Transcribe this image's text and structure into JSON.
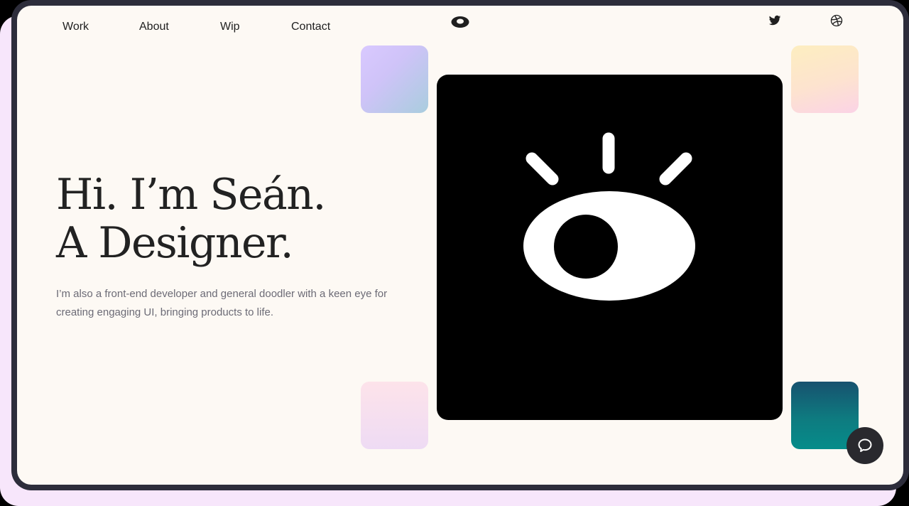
{
  "nav": {
    "items": [
      {
        "label": "Work"
      },
      {
        "label": "About"
      },
      {
        "label": "Wip"
      },
      {
        "label": "Contact"
      }
    ],
    "logo_icon": "eye-icon",
    "social": [
      {
        "icon": "twitter-icon"
      },
      {
        "icon": "dribbble-icon"
      }
    ]
  },
  "hero": {
    "title_line1": "Hi. I’m Seán.",
    "title_line2": "A Designer.",
    "subtitle": "I’m also a front-end developer and general doodler with a keen eye for creating engaging UI, bringing products to life."
  },
  "tiles": {
    "colors": [
      "#d9c9ff",
      "#fdeec0",
      "#fde3ea",
      "#0e7b80"
    ]
  },
  "chat": {
    "icon": "chat-bubble-icon"
  },
  "colors": {
    "page_bg": "#fdf9f4",
    "frame": "#2d2d3b",
    "text": "#222222",
    "muted": "#6c6b76"
  }
}
